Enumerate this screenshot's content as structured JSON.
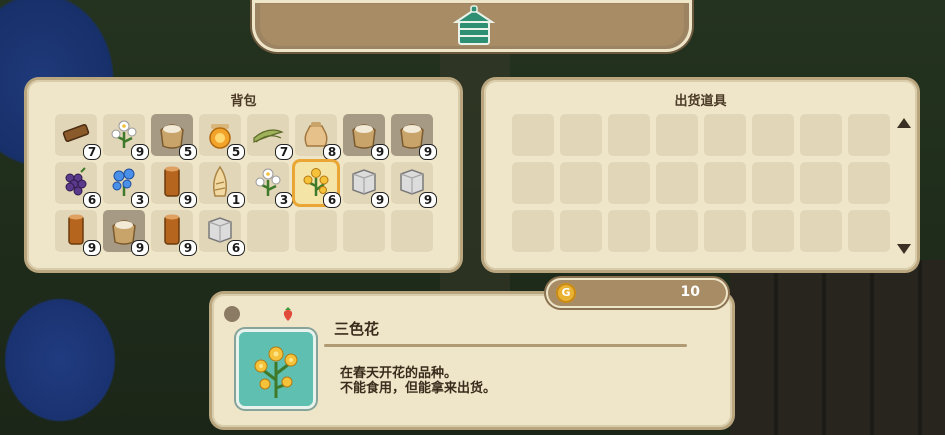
{
  "top_bar": {
    "icon": "shipping-bin-icon"
  },
  "bag": {
    "title": "背包",
    "items": [
      {
        "icon": "wood-plank-icon",
        "qty": "7"
      },
      {
        "icon": "white-flower-icon",
        "qty": "9"
      },
      {
        "icon": "seed-bag-icon",
        "qty": "5",
        "dark": true
      },
      {
        "icon": "honey-jar-icon",
        "qty": "5"
      },
      {
        "icon": "grass-icon",
        "qty": "7"
      },
      {
        "icon": "sack-icon",
        "qty": "8"
      },
      {
        "icon": "seed-bag-icon",
        "qty": "9",
        "dark": true
      },
      {
        "icon": "seed-bag-icon",
        "qty": "9",
        "dark": true
      },
      {
        "icon": "grapes-icon",
        "qty": "6"
      },
      {
        "icon": "blue-flower-icon",
        "qty": "3"
      },
      {
        "icon": "log-icon",
        "qty": "9"
      },
      {
        "icon": "bamboo-shoot-icon",
        "qty": "1"
      },
      {
        "icon": "white-flower-icon",
        "qty": "3"
      },
      {
        "icon": "yellow-flower-icon",
        "qty": "6",
        "selected": true
      },
      {
        "icon": "stone-icon",
        "qty": "9"
      },
      {
        "icon": "stone-icon",
        "qty": "9"
      },
      {
        "icon": "log-icon",
        "qty": "9"
      },
      {
        "icon": "seed-bag-icon",
        "qty": "9",
        "dark": true
      },
      {
        "icon": "log-icon",
        "qty": "9"
      },
      {
        "icon": "stone-icon",
        "qty": "6"
      }
    ],
    "total_slots": 24
  },
  "ship": {
    "title": "出货道具",
    "total_slots": 24
  },
  "coin": {
    "amount": "10",
    "symbol": "G"
  },
  "detail": {
    "name": "三色花",
    "desc_line1": "在春天开花的品种。",
    "desc_line2": "不能食用，但能拿来出货。"
  }
}
